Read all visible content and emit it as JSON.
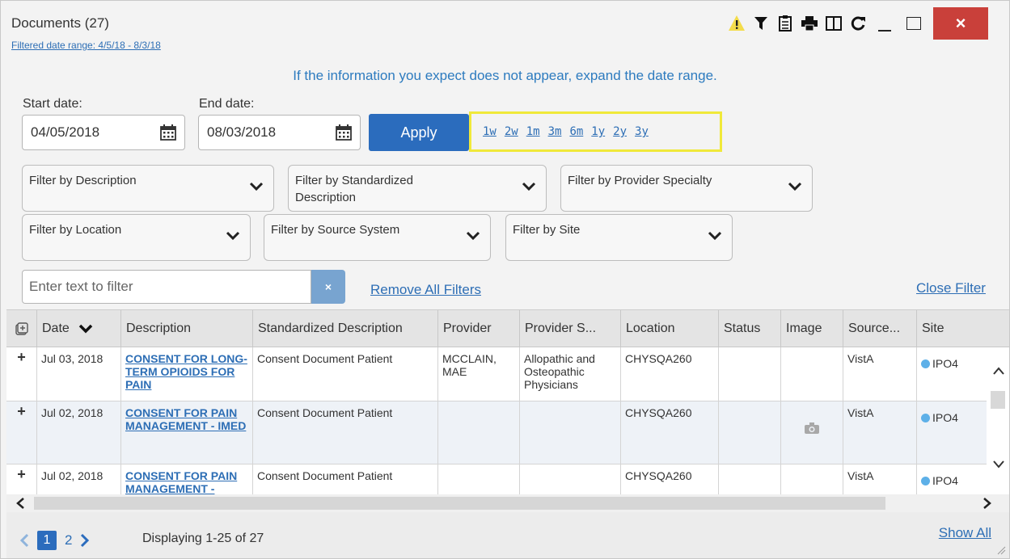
{
  "header": {
    "title": "Documents (27)",
    "range_link": "Filtered date range: 4/5/18 - 8/3/18",
    "close_label": "×"
  },
  "info_message": "If the information you expect does not appear, expand the date range.",
  "dates": {
    "start_label": "Start date:",
    "start_value": "04/05/2018",
    "end_label": "End date:",
    "end_value": "08/03/2018",
    "apply_label": "Apply"
  },
  "quick_ranges": [
    "1w",
    "2w",
    "1m",
    "3m",
    "6m",
    "1y",
    "2y",
    "3y"
  ],
  "filters": {
    "description": "Filter by Description",
    "standardized": "Filter by Standardized Description",
    "specialty": "Filter by Provider Specialty",
    "location": "Filter by Location",
    "source": "Filter by Source System",
    "site": "Filter by Site"
  },
  "text_filter": {
    "placeholder": "Enter text to filter",
    "clear_label": "×"
  },
  "remove_all": "Remove All Filters",
  "close_filter": "Close Filter",
  "columns": [
    "Date",
    "Description",
    "Standardized Description",
    "Provider",
    "Provider S...",
    "Location",
    "Status",
    "Image",
    "Source...",
    "Site"
  ],
  "rows": [
    {
      "expand": "+",
      "date": "Jul 03, 2018",
      "description": "CONSENT FOR LONG-TERM OPIOIDS FOR PAIN",
      "standardized": "Consent Document Patient",
      "provider": "MCCLAIN, MAE",
      "specialty": "Allopathic and Osteopathic Physicians",
      "location": "CHYSQA260",
      "status": "",
      "has_image": false,
      "source": "VistA",
      "site": "IPO4"
    },
    {
      "expand": "+",
      "date": "Jul 02, 2018",
      "description": "CONSENT FOR PAIN MANAGEMENT - IMED",
      "standardized": "Consent Document Patient",
      "provider": "",
      "specialty": "",
      "location": "CHYSQA260",
      "status": "",
      "has_image": true,
      "source": "VistA",
      "site": "IPO4"
    },
    {
      "expand": "+",
      "date": "Jul 02, 2018",
      "description": "CONSENT FOR PAIN MANAGEMENT -",
      "standardized": "Consent Document Patient",
      "provider": "",
      "specialty": "",
      "location": "CHYSQA260",
      "status": "",
      "has_image": false,
      "source": "VistA",
      "site": "IPO4"
    }
  ],
  "footer": {
    "pages": [
      "1",
      "2"
    ],
    "current_page": "1",
    "display_text": "Displaying 1-25 of 27",
    "show_all": "Show All"
  },
  "colors": {
    "accent": "#2b6cbd",
    "link": "#2d6eb5",
    "close": "#c9403a",
    "highlight": "#f0e93a",
    "site_dot": "#5db0e8"
  }
}
